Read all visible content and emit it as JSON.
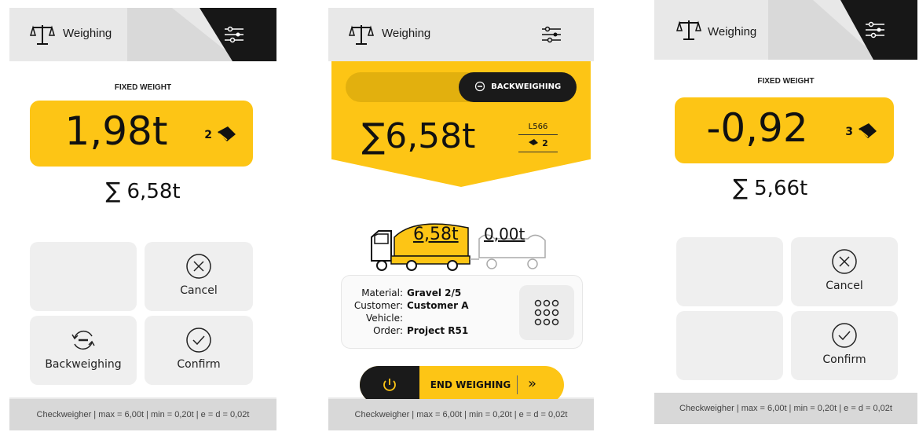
{
  "app": {
    "title": "Weighing",
    "footer": "Checkweigher | max = 6,00t | min = 0,20t | e = d = 0,02t"
  },
  "colors": {
    "accent": "#fdc515",
    "dark": "#1a1a1a"
  },
  "screen1": {
    "mode_label": "FIXED WEIGHT",
    "current_weight": "1,98t",
    "bucket_count": "2",
    "sum_weight": "6,58t",
    "buttons": {
      "cancel": "Cancel",
      "backweighing": "Backweighing",
      "confirm": "Confirm"
    }
  },
  "screen2": {
    "toggle_label": "BACKWEIGHING",
    "total_weight": "6,58t",
    "loader_id": "L566",
    "bucket_count": "2",
    "truck_weight": "6,58t",
    "trailer_weight": "0,00t",
    "info": {
      "material_key": "Material:",
      "material_val": "Gravel 2/5",
      "customer_key": "Customer:",
      "customer_val": "Customer A",
      "vehicle_key": "Vehicle:",
      "vehicle_val": "",
      "order_key": "Order:",
      "order_val": "Project R51"
    },
    "end_label": "END WEIGHING"
  },
  "screen3": {
    "mode_label": "FIXED WEIGHT",
    "current_weight": "-0,92",
    "bucket_count": "3",
    "sum_weight": "5,66t",
    "buttons": {
      "cancel": "Cancel",
      "confirm": "Confirm"
    }
  }
}
